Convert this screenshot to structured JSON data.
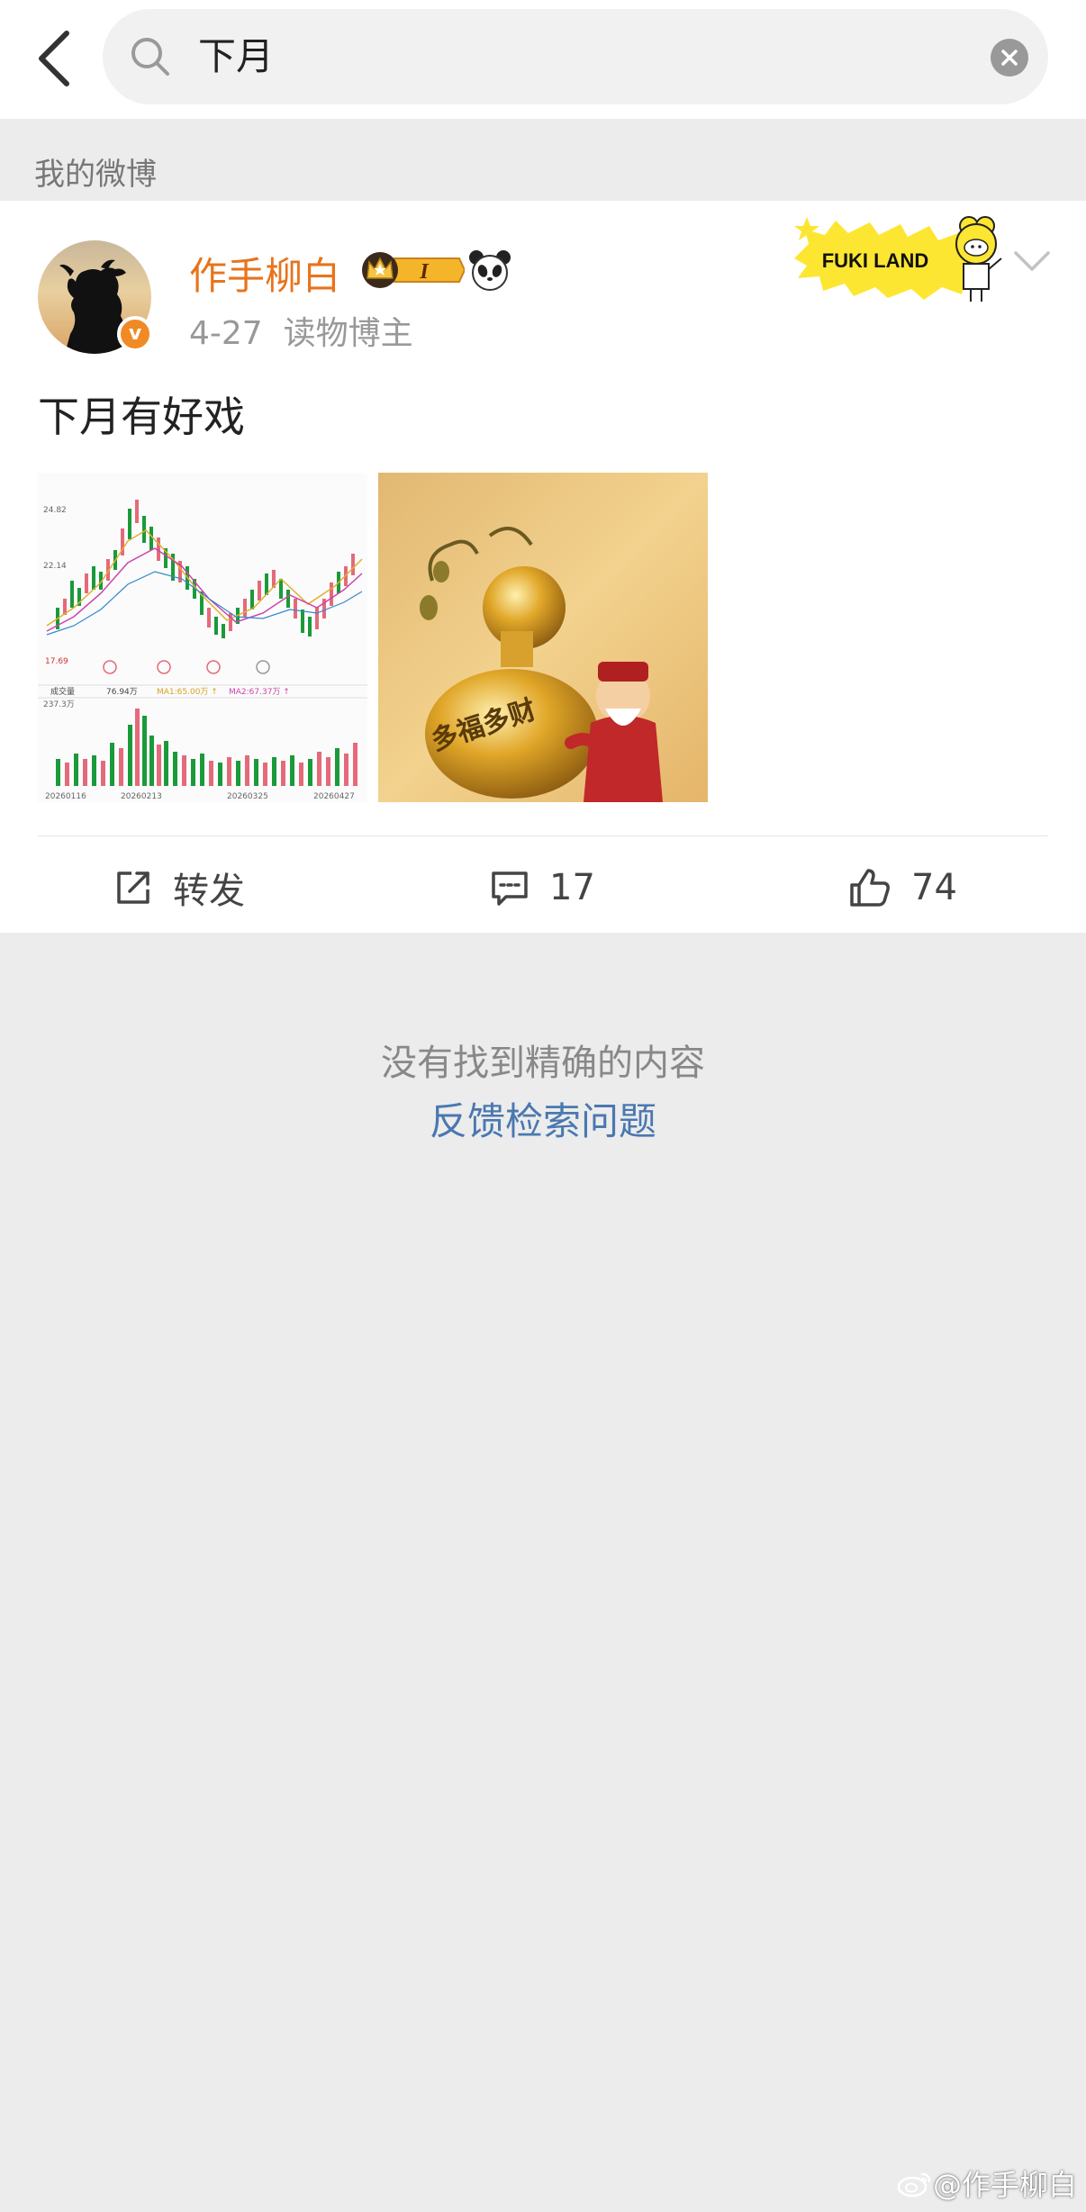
{
  "search": {
    "query": "下月"
  },
  "section": {
    "label": "我的微博"
  },
  "post": {
    "author": "作手柳白",
    "author_badge": "I",
    "date": "4-27",
    "source": "读物博主",
    "text": "下月有好戏",
    "banner_text": "FUKI LAND",
    "images": {
      "chart": {
        "price_labels": [
          "24.82",
          "22.14"
        ],
        "last_price": "17.69",
        "volume_label": "成交量",
        "volume_value": "76.94万",
        "ma1": "MA1:65.00万 ↑",
        "ma2": "MA2:67.37万 ↑",
        "volume_max": "237.3万",
        "dates": [
          "20260116",
          "20260213",
          "20260325",
          "20260427"
        ]
      },
      "gourd": {
        "characters": "多福多财"
      }
    },
    "actions": {
      "repost_label": "转发",
      "comment_count": "17",
      "like_count": "74"
    }
  },
  "empty_state": {
    "message": "没有找到精确的内容",
    "feedback_link": "反馈检索问题"
  },
  "watermark": {
    "text": "@作手柳白"
  },
  "colors": {
    "accent_orange": "#e8731c",
    "link_blue": "#4a78b0",
    "page_bg": "#ececec"
  }
}
